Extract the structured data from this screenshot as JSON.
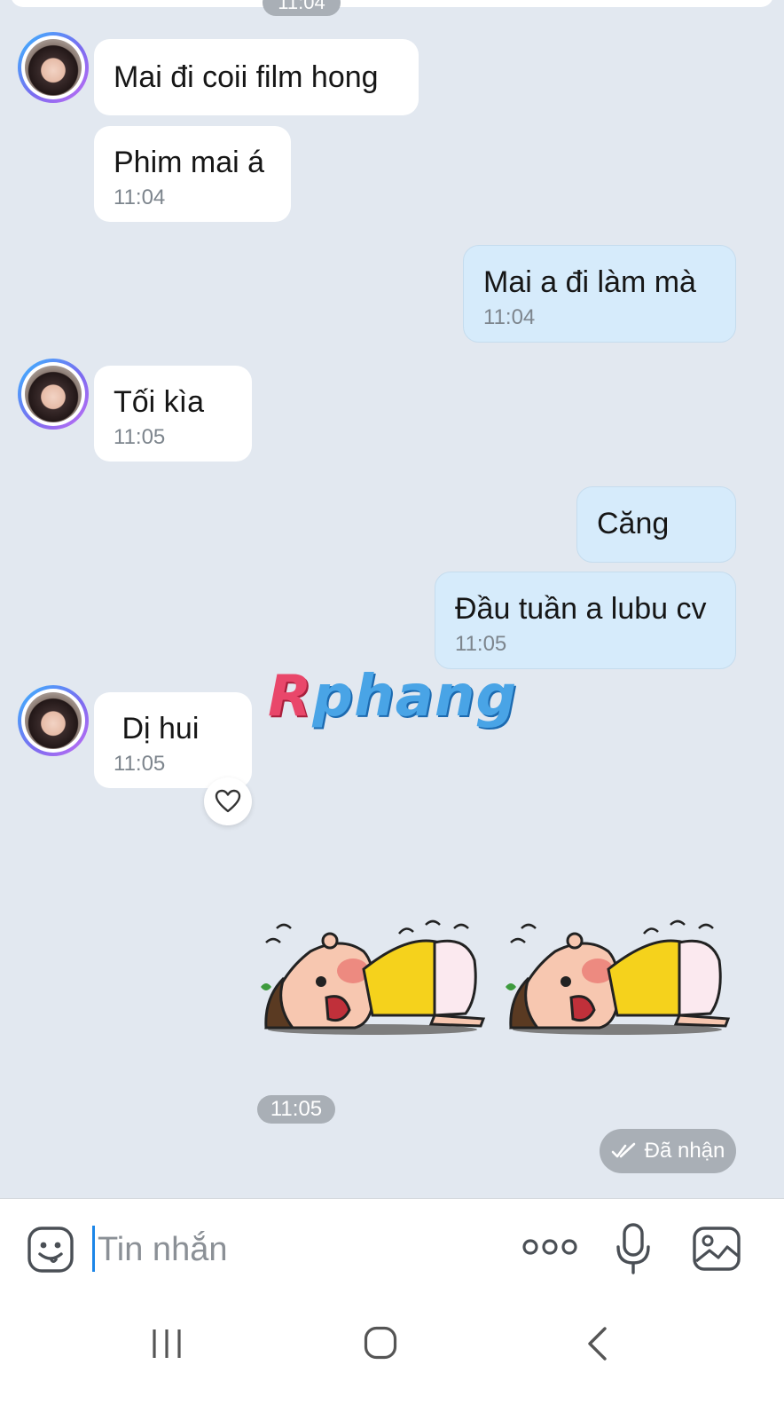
{
  "chat": {
    "top_time": "11:04",
    "messages": [
      {
        "side": "in",
        "text": "Mai đi coii film hong",
        "time": ""
      },
      {
        "side": "in",
        "text": "Phim mai á",
        "time": "11:04"
      },
      {
        "side": "out",
        "text": "Mai a đi làm mà",
        "time": "11:04"
      },
      {
        "side": "in",
        "text": "Tối kìa",
        "time": "11:05"
      },
      {
        "side": "out",
        "text": "Căng",
        "time": ""
      },
      {
        "side": "out",
        "text": "Đầu tuần a lubu cv",
        "time": "11:05"
      },
      {
        "side": "in",
        "text": " Dị hui",
        "time": "11:05"
      }
    ],
    "sticker_time": "11:05",
    "status": "Đã nhận"
  },
  "watermark": {
    "first": "R",
    "rest": "phang"
  },
  "composer": {
    "placeholder": "Tin nhắn"
  },
  "colors": {
    "background": "#e2e8f0",
    "incoming_bubble": "#ffffff",
    "outgoing_bubble": "#d6ebfb",
    "accent": "#1b86e8"
  },
  "icons": {
    "emoji": "smiley-icon",
    "more": "more-dots-icon",
    "mic": "microphone-icon",
    "image": "image-icon",
    "heart": "heart-icon",
    "status": "double-check-icon",
    "nav": [
      "recent-apps-icon",
      "home-icon",
      "back-icon"
    ]
  }
}
